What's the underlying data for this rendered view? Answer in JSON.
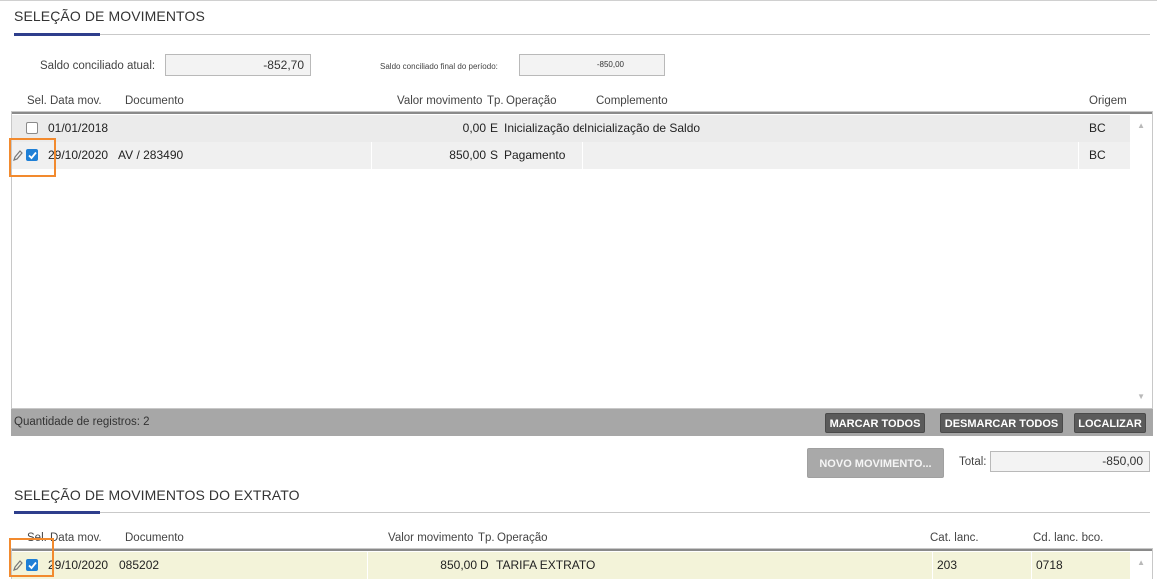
{
  "section1": {
    "title": "SELEÇÃO DE MOVIMENTOS",
    "saldo_atual_label": "Saldo conciliado atual:",
    "saldo_atual_value": "-852,70",
    "saldo_final_label": "Saldo conciliado final do período:",
    "saldo_final_value": "-850,00",
    "headers": {
      "sel": "Sel.",
      "data": "Data mov.",
      "documento": "Documento",
      "valor": "Valor movimento",
      "tp": "Tp.",
      "operacao": "Operação",
      "complemento": "Complemento",
      "origem": "Origem"
    },
    "rows": [
      {
        "checked": false,
        "data": "01/01/2018",
        "documento": "",
        "valor": "0,00",
        "tp": "E",
        "operacao": "Inicialização de",
        "complemento": "Inicialização de Saldo",
        "origem": "BC"
      },
      {
        "checked": true,
        "data": "29/10/2020",
        "documento": "AV / 283490",
        "valor": "850,00",
        "tp": "S",
        "operacao": "Pagamento",
        "complemento": "",
        "origem": "BC"
      }
    ],
    "footer": {
      "count_label": "Quantidade de registros: 2",
      "marcar_todos": "MARCAR TODOS",
      "desmarcar_todos": "DESMARCAR TODOS",
      "localizar": "LOCALIZAR"
    },
    "novo_movimento": "NOVO MOVIMENTO...",
    "total_label": "Total:",
    "total_value": "-850,00"
  },
  "section2": {
    "title": "SELEÇÃO DE MOVIMENTOS DO EXTRATO",
    "headers": {
      "sel": "Sel.",
      "data": "Data mov.",
      "documento": "Documento",
      "valor": "Valor movimento",
      "tp": "Tp.",
      "operacao": "Operação",
      "cat": "Cat. lanc.",
      "cd": "Cd. lanc. bco."
    },
    "rows": [
      {
        "checked": true,
        "data": "29/10/2020",
        "documento": "085202",
        "valor": "850,00",
        "tp": "D",
        "operacao": "TARIFA EXTRATO",
        "cat": "203",
        "cd": "0718"
      }
    ]
  },
  "colors": {
    "accent": "#2e3e8c",
    "highlight": "#f28a2e",
    "checkbox": "#1e7fd6",
    "extrato_row": "#f3f3d9"
  }
}
